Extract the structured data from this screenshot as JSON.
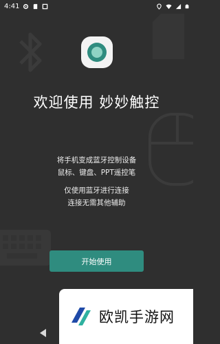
{
  "status_bar": {
    "time": "4:41",
    "icons_left": [
      "gear-icon",
      "sim-card-icon",
      "square-icon"
    ],
    "icons_right": [
      "location-icon",
      "wifi-icon",
      "cellular-icon",
      "battery-icon"
    ]
  },
  "welcome": {
    "title": "欢迎使用 妙妙触控",
    "desc_line1": "将手机变成蓝牙控制设备",
    "desc_line2": "鼠标、键盘、PPT遥控笔",
    "desc_line3": "仅使用蓝牙进行连接",
    "desc_line4": "连接无需其他辅助"
  },
  "start_button": {
    "label": "开始使用"
  },
  "watermark": {
    "text": "欧凯手游网"
  },
  "colors": {
    "background": "#2f2f2f",
    "accent": "#2f8c7f",
    "icon_background": "#f3f3f3"
  }
}
